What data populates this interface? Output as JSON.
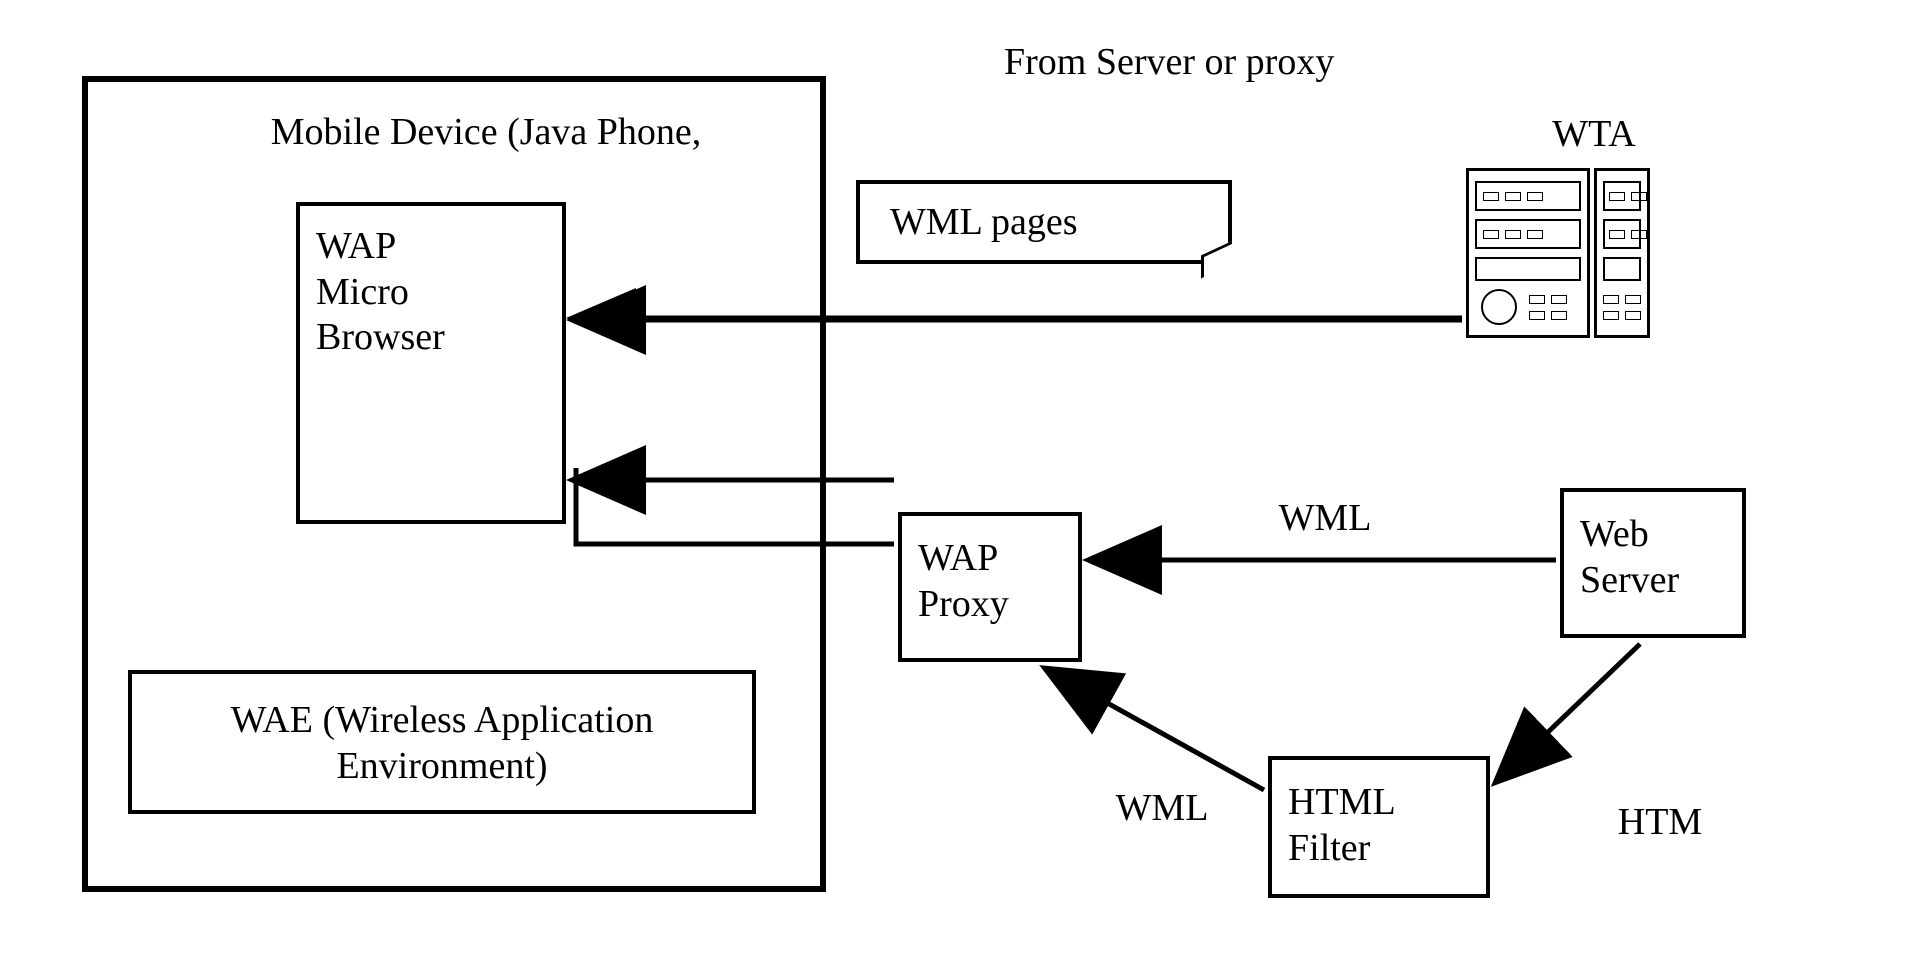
{
  "labels": {
    "header_right": "From Server or proxy",
    "wta": "WTA",
    "mobile_device": "Mobile Device (Java Phone,",
    "wap_micro_browser": "WAP\nMicro\nBrowser",
    "wml_pages": "WML pages",
    "wae": "WAE (Wireless Application Environment)",
    "wap_proxy": "WAP\nProxy",
    "web_server": "Web\nServer",
    "html_filter": "HTML\nFilter",
    "wml_top": "WML",
    "wml_bottom": "WML",
    "htm": "HTM"
  }
}
